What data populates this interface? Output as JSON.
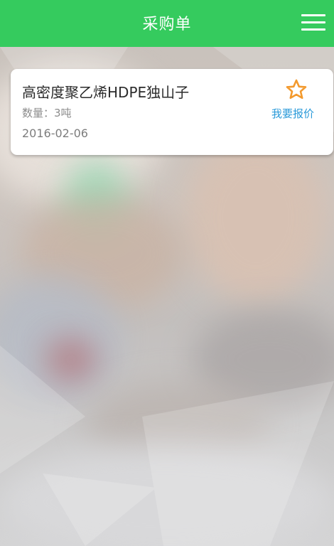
{
  "header": {
    "title": "采购单",
    "menu_icon": "hamburger-menu-icon"
  },
  "colors": {
    "header_bg": "#35cb5e",
    "accent_orange": "#f39a2e",
    "link_blue": "#2a9ad9"
  },
  "purchase_items": [
    {
      "name": "高密度聚乙烯HDPE独山子",
      "quantity": "数量：3吨",
      "date": "2016-02-06",
      "favorite_icon": "star-outline-icon",
      "quote_label": "我要报价"
    }
  ]
}
